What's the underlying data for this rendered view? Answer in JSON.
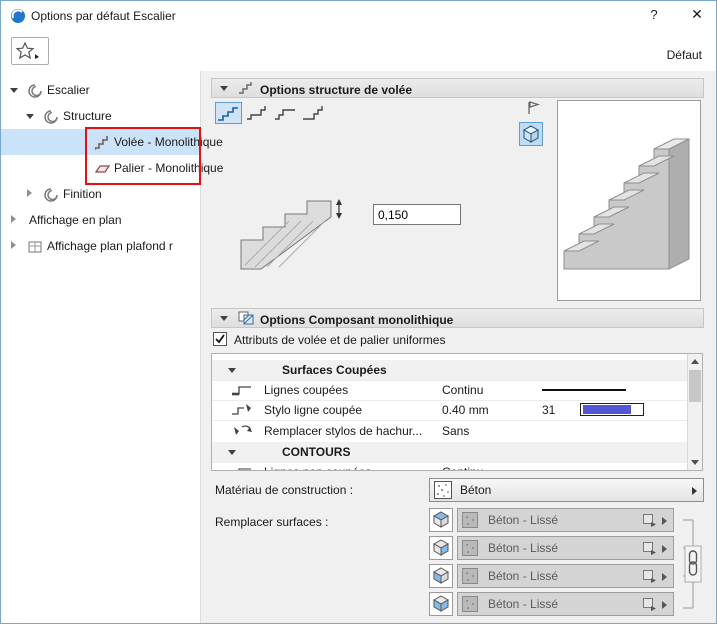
{
  "window": {
    "title": "Options par défaut Escalier",
    "help_label": "?",
    "close_label": "✕",
    "default_label": "Défaut"
  },
  "tree": {
    "items": [
      {
        "label": "Escalier"
      },
      {
        "label": "Structure"
      },
      {
        "label": "Volée - Monolithique"
      },
      {
        "label": "Palier - Monolithique"
      },
      {
        "label": "Finition"
      },
      {
        "label": "Affichage en plan"
      },
      {
        "label": "Affichage plan plafond r"
      }
    ]
  },
  "flight_panel": {
    "title": "Options structure de volée",
    "riser_height": "0,150"
  },
  "component_panel": {
    "title": "Options Composant monolithique",
    "uniform_checkbox_label": "Attributs de volée et de palier uniformes",
    "table": {
      "group1": "Surfaces Coupées",
      "rows": [
        {
          "label": "Lignes coupées",
          "value": "Continu"
        },
        {
          "label": "Stylo ligne coupée",
          "value": "0.40 mm",
          "pen_number": "31"
        },
        {
          "label": "Remplacer stylos de hachur...",
          "value": "Sans"
        }
      ],
      "group2": "CONTOURS",
      "rows2": [
        {
          "label": "Lignes non coupées",
          "value": "Continu"
        }
      ]
    },
    "material_label": "Matériau de construction :",
    "material_value": "Béton",
    "surfaces_label": "Remplacer surfaces :",
    "surface_options": [
      {
        "value": "Béton - Lissé"
      },
      {
        "value": "Béton - Lissé"
      },
      {
        "value": "Béton - Lissé"
      },
      {
        "value": "Béton - Lissé"
      }
    ]
  },
  "colors": {
    "selection": "#cbe3f8",
    "annotation_red": "#e01212",
    "pen_swatch": "#5556d6"
  }
}
